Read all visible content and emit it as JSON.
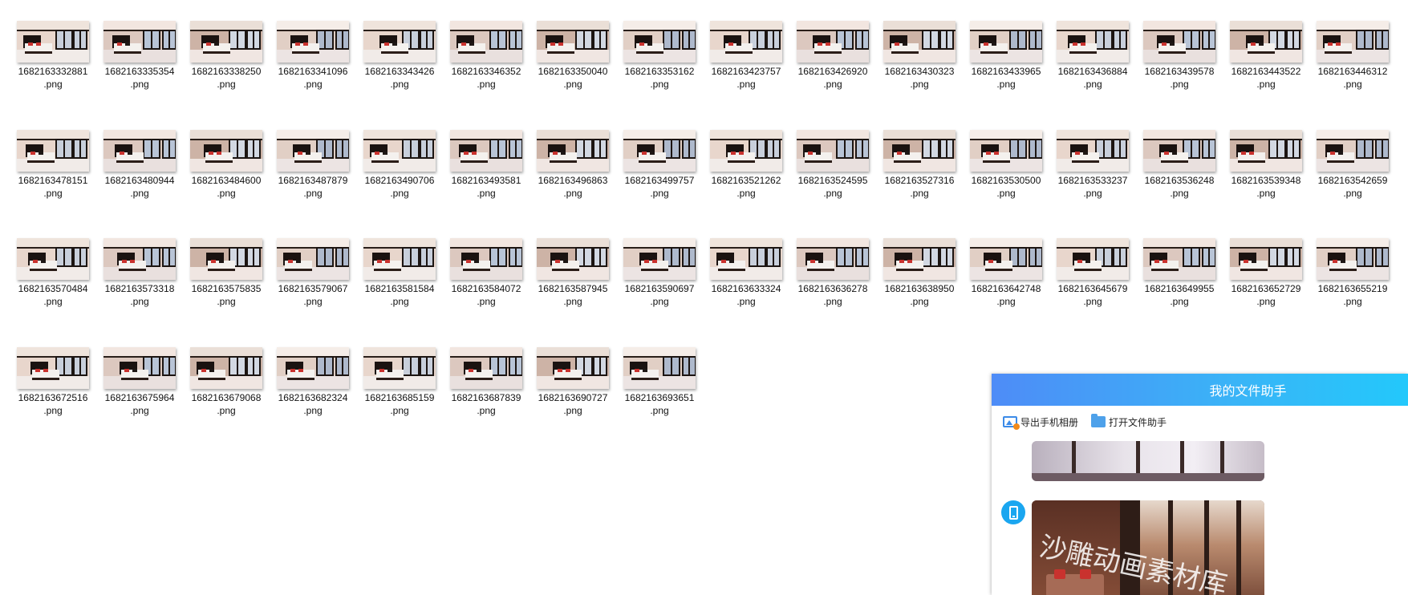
{
  "files": [
    {
      "line1": "1682163332881",
      "line2": ".png"
    },
    {
      "line1": "1682163335354",
      "line2": ".png"
    },
    {
      "line1": "1682163338250",
      "line2": ".png"
    },
    {
      "line1": "1682163341096",
      "line2": ".png"
    },
    {
      "line1": "1682163343426",
      "line2": ".png"
    },
    {
      "line1": "1682163346352",
      "line2": ".png"
    },
    {
      "line1": "1682163350040",
      "line2": ".png"
    },
    {
      "line1": "1682163353162",
      "line2": ".png"
    },
    {
      "line1": "1682163423757",
      "line2": ".png"
    },
    {
      "line1": "1682163426920",
      "line2": ".png"
    },
    {
      "line1": "1682163430323",
      "line2": ".png"
    },
    {
      "line1": "1682163433965",
      "line2": ".png"
    },
    {
      "line1": "1682163436884",
      "line2": ".png"
    },
    {
      "line1": "1682163439578",
      "line2": ".png"
    },
    {
      "line1": "1682163443522",
      "line2": ".png"
    },
    {
      "line1": "1682163446312",
      "line2": ".png"
    },
    {
      "line1": "1682163478151",
      "line2": ".png"
    },
    {
      "line1": "1682163480944",
      "line2": ".png"
    },
    {
      "line1": "1682163484600",
      "line2": ".png"
    },
    {
      "line1": "1682163487879",
      "line2": ".png"
    },
    {
      "line1": "1682163490706",
      "line2": ".png"
    },
    {
      "line1": "1682163493581",
      "line2": ".png"
    },
    {
      "line1": "1682163496863",
      "line2": ".png"
    },
    {
      "line1": "1682163499757",
      "line2": ".png"
    },
    {
      "line1": "1682163521262",
      "line2": ".png"
    },
    {
      "line1": "1682163524595",
      "line2": ".png"
    },
    {
      "line1": "1682163527316",
      "line2": ".png"
    },
    {
      "line1": "1682163530500",
      "line2": ".png"
    },
    {
      "line1": "1682163533237",
      "line2": ".png"
    },
    {
      "line1": "1682163536248",
      "line2": ".png"
    },
    {
      "line1": "1682163539348",
      "line2": ".png"
    },
    {
      "line1": "1682163542659",
      "line2": ".png"
    },
    {
      "line1": "1682163570484",
      "line2": ".png"
    },
    {
      "line1": "1682163573318",
      "line2": ".png"
    },
    {
      "line1": "1682163575835",
      "line2": ".png"
    },
    {
      "line1": "1682163579067",
      "line2": ".png"
    },
    {
      "line1": "1682163581584",
      "line2": ".png"
    },
    {
      "line1": "1682163584072",
      "line2": ".png"
    },
    {
      "line1": "1682163587945",
      "line2": ".png"
    },
    {
      "line1": "1682163590697",
      "line2": ".png"
    },
    {
      "line1": "1682163633324",
      "line2": ".png"
    },
    {
      "line1": "1682163636278",
      "line2": ".png"
    },
    {
      "line1": "1682163638950",
      "line2": ".png"
    },
    {
      "line1": "1682163642748",
      "line2": ".png"
    },
    {
      "line1": "1682163645679",
      "line2": ".png"
    },
    {
      "line1": "1682163649955",
      "line2": ".png"
    },
    {
      "line1": "1682163652729",
      "line2": ".png"
    },
    {
      "line1": "1682163655219",
      "line2": ".png"
    },
    {
      "line1": "1682163672516",
      "line2": ".png"
    },
    {
      "line1": "1682163675964",
      "line2": ".png"
    },
    {
      "line1": "1682163679068",
      "line2": ".png"
    },
    {
      "line1": "1682163682324",
      "line2": ".png"
    },
    {
      "line1": "1682163685159",
      "line2": ".png"
    },
    {
      "line1": "1682163687839",
      "line2": ".png"
    },
    {
      "line1": "1682163690727",
      "line2": ".png"
    },
    {
      "line1": "1682163693651",
      "line2": ".png"
    }
  ],
  "assistant": {
    "title": "我的文件助手",
    "export_album_label": "导出手机相册",
    "open_assistant_label": "打开文件助手",
    "watermark_text": "沙雕动画素材库",
    "export_icon": "album-export-icon",
    "open_icon": "folder-icon",
    "avatar_icon": "phone-icon"
  },
  "colors": {
    "header_start": "#4e8cf7",
    "header_end": "#23c8fb",
    "avatar": "#1aa6f0",
    "accent_red": "#c9322e"
  }
}
